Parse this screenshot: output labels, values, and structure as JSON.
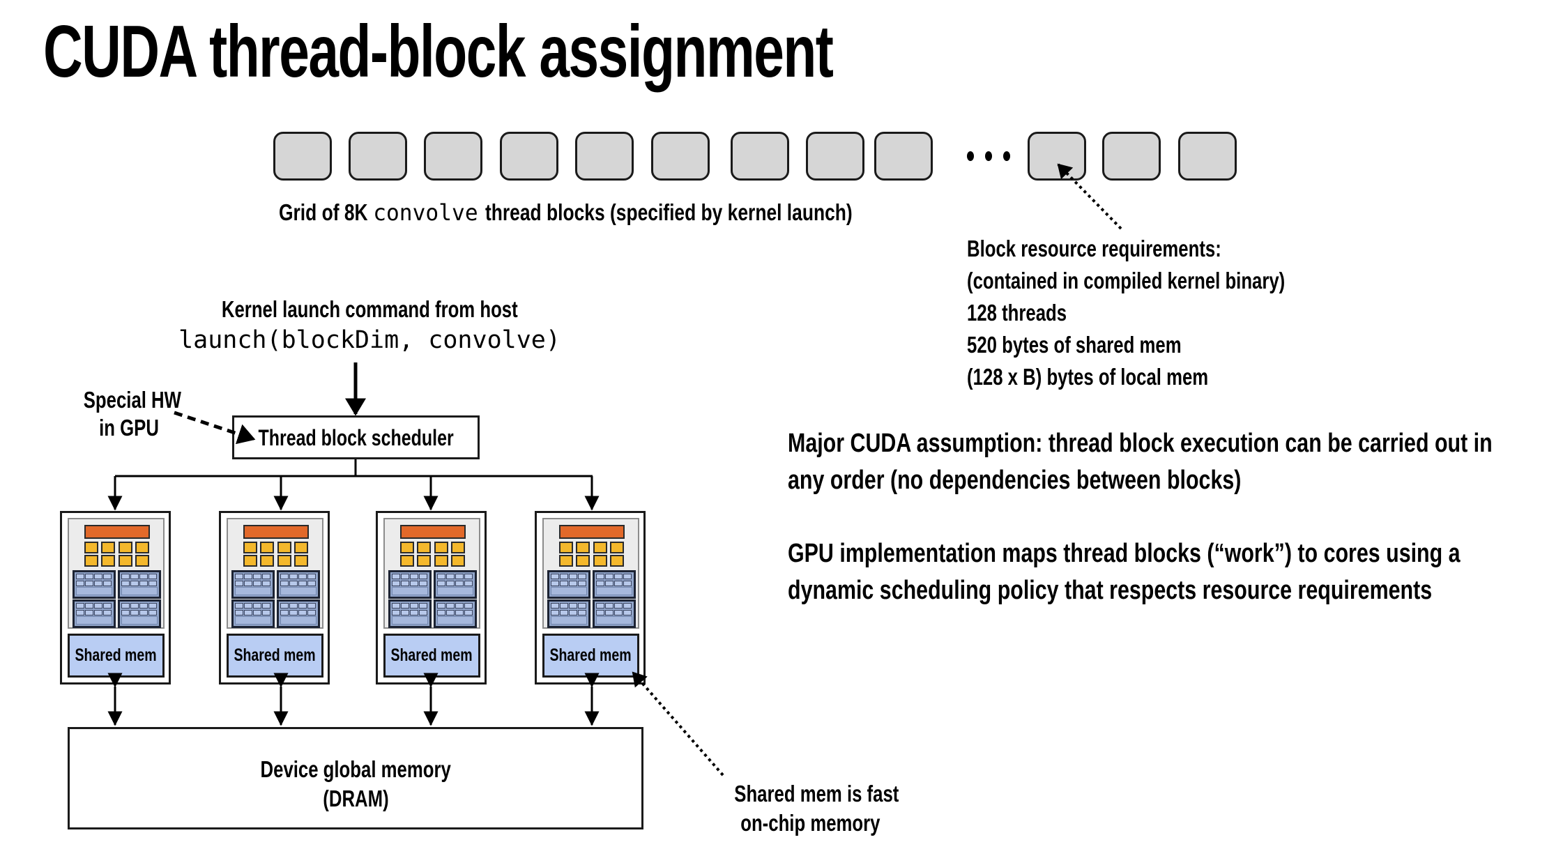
{
  "title": "CUDA thread-block assignment",
  "grid": {
    "visible_blocks_before_ellipsis": 9,
    "visible_blocks_after_ellipsis": 3,
    "ellipsis": "•••",
    "caption_prefix": "Grid of 8K",
    "caption_code": "convolve",
    "caption_suffix": "thread blocks (specified by kernel launch)"
  },
  "block_requirements": {
    "lines": [
      "Block resource requirements:",
      "(contained in compiled kernel binary)",
      "128 threads",
      "520 bytes of shared mem",
      "(128 x B) bytes of local mem"
    ]
  },
  "launch": {
    "heading": "Kernel launch command from host",
    "code": "launch(blockDim, convolve)"
  },
  "special_hw": {
    "line1": "Special HW",
    "line2": "in GPU"
  },
  "scheduler": {
    "label": "Thread block scheduler"
  },
  "cores": [
    {
      "shared_mem_label": "Shared mem"
    },
    {
      "shared_mem_label": "Shared mem"
    },
    {
      "shared_mem_label": "Shared mem"
    },
    {
      "shared_mem_label": "Shared mem"
    }
  ],
  "dram": {
    "line1": "Device global memory",
    "line2": "(DRAM)"
  },
  "shared_mem_note": {
    "line1": "Shared mem is fast",
    "line2": "on-chip memory"
  },
  "notes": {
    "assumption": [
      "Major CUDA assumption: thread block execution can be carried out in",
      "any order (no dependencies between blocks)"
    ],
    "implementation": [
      "GPU implementation maps thread blocks (“work”) to cores using a",
      "dynamic scheduling policy that respects resource requirements"
    ]
  },
  "colors": {
    "thread_block_fill": "#d6d6d6",
    "fetch_decode": "#e2692a",
    "alu": "#f4b82c",
    "exec_context": "#92a6cb",
    "shared_mem": "#b9cdf3",
    "core_panel": "#ececec"
  }
}
